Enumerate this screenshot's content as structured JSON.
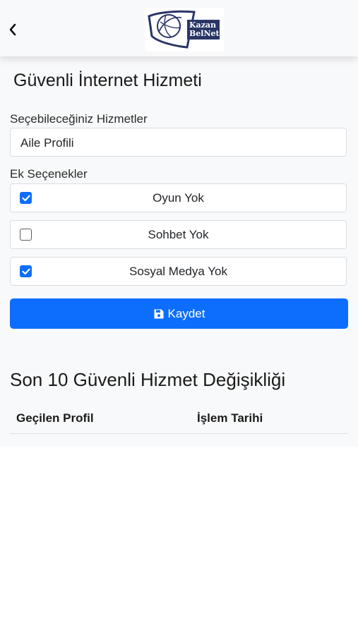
{
  "header": {
    "back_icon": "chevron-left-icon",
    "logo_line1": "Kazan",
    "logo_line2": "BelNet"
  },
  "page": {
    "title": "Güvenli İnternet Hizmeti"
  },
  "services": {
    "label": "Seçebileceğiniz Hizmetler",
    "selected": "Aile Profili"
  },
  "options": {
    "label": "Ek Seçenekler",
    "items": [
      {
        "label": "Oyun Yok",
        "checked": true
      },
      {
        "label": "Sohbet Yok",
        "checked": false
      },
      {
        "label": "Sosyal Medya Yok",
        "checked": true
      }
    ]
  },
  "save": {
    "label": "Kaydet",
    "icon": "floppy-disk-icon"
  },
  "history": {
    "title": "Son 10 Güvenli Hizmet Değişikliği",
    "columns": [
      "Geçilen Profil",
      "İşlem Tarihi"
    ]
  },
  "colors": {
    "accent": "#0d6efd",
    "background": "#f8f9fa"
  }
}
